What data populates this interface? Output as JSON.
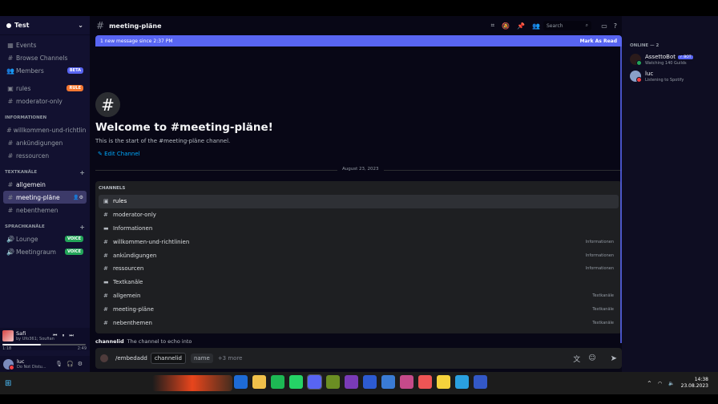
{
  "server": {
    "name": "Test"
  },
  "sidebar": {
    "top_items": [
      {
        "icon": "calendar-icon",
        "label": "Events"
      },
      {
        "icon": "browse-icon",
        "label": "Browse Channels"
      },
      {
        "icon": "members-icon",
        "label": "Members",
        "badge": "BETA"
      }
    ],
    "channels": [
      {
        "label": "rules",
        "badge": "RULE"
      },
      {
        "label": "moderator-only"
      }
    ],
    "categories": [
      {
        "name": "INFORMATIONEN",
        "channels": [
          "willkommen-und-richtlin...",
          "ankündigungen",
          "ressourcen"
        ]
      },
      {
        "name": "TEXTKANÄLE",
        "channels": [
          "allgemein",
          "meeting-pläne",
          "nebenthemen"
        ]
      },
      {
        "name": "SPRACHKANÄLE",
        "voice": [
          {
            "label": "Lounge",
            "badge": "VOICE"
          },
          {
            "label": "Meetingraum",
            "badge": "VOICE"
          }
        ]
      }
    ]
  },
  "player": {
    "title": "Safi",
    "artist": "by Ufo361; Soufian",
    "elapsed": "1:18",
    "duration": "2:49",
    "progress": 0.46
  },
  "user": {
    "name": "luc",
    "status": "Do Not Distu..."
  },
  "header": {
    "channel": "meeting-pläne",
    "search_placeholder": "Search"
  },
  "newbar": {
    "text": "1 new message since 2:37 PM",
    "action": "Mark As Read"
  },
  "welcome": {
    "title": "Welcome to #meeting-pläne!",
    "subtitle": "This is the start of the #meeting-pläne channel.",
    "edit": "Edit Channel"
  },
  "divider_date": "August 23, 2023",
  "popup": {
    "header": "CHANNELS",
    "options": [
      {
        "type": "rules",
        "label": "rules",
        "category": ""
      },
      {
        "type": "text",
        "label": "moderator-only",
        "category": ""
      },
      {
        "type": "folder",
        "label": "Informationen",
        "category": ""
      },
      {
        "type": "text",
        "label": "willkommen-und-richtlinien",
        "category": "Informationen"
      },
      {
        "type": "text",
        "label": "ankündigungen",
        "category": "Informationen"
      },
      {
        "type": "text",
        "label": "ressourcen",
        "category": "Informationen"
      },
      {
        "type": "folder",
        "label": "Textkanäle",
        "category": ""
      },
      {
        "type": "text",
        "label": "allgemein",
        "category": "Textkanäle"
      },
      {
        "type": "text",
        "label": "meeting-pläne",
        "category": "Textkanäle"
      },
      {
        "type": "text",
        "label": "nebenthemen",
        "category": "Textkanäle"
      }
    ]
  },
  "param_hint": {
    "name": "channelid",
    "desc": "The channel to echo into"
  },
  "input": {
    "command": "/embedadd",
    "active_param": "channelid",
    "next_param": "name",
    "more": "+3 more"
  },
  "members": {
    "header": "ONLINE — 2",
    "list": [
      {
        "name": "AssettoBot",
        "badge": "✓ BOT",
        "status": "Watching 140 Guilds",
        "kind": "bot"
      },
      {
        "name": "luc",
        "badge": "",
        "status": "Listening to Spotify",
        "kind": "user"
      }
    ]
  },
  "taskbar": {
    "time": "14:38",
    "date": "23.08.2023",
    "apps": [
      "#1e6bd6",
      "#f0c04a",
      "#1db954",
      "#25d366",
      "#5865f2",
      "#6b8e23",
      "#7a3bb8",
      "#2d5bd2",
      "#3a7bd5",
      "#c54a8a",
      "#e55",
      "#f4d23c",
      "#2aa0e0",
      "#3358c6"
    ]
  }
}
